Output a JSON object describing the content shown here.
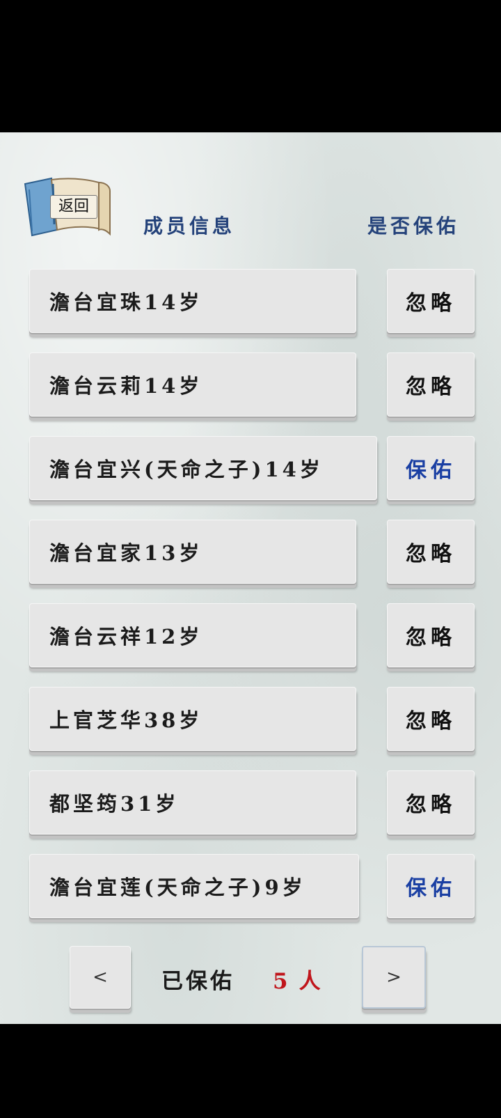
{
  "header": {
    "back_label": "返回",
    "col_member_info": "成员信息",
    "col_protect": "是否保佑"
  },
  "members": [
    {
      "name": "澹台宜珠14岁",
      "action": "忽略"
    },
    {
      "name": "澹台云莉14岁",
      "action": "忽略"
    },
    {
      "name": "澹台宜兴(天命之子)14岁",
      "action": "保佑"
    },
    {
      "name": "澹台宜家13岁",
      "action": "忽略"
    },
    {
      "name": "澹台云祥12岁",
      "action": "忽略"
    },
    {
      "name": "上官芝华38岁",
      "action": "忽略"
    },
    {
      "name": "都坚筠31岁",
      "action": "忽略"
    },
    {
      "name": "澹台宜莲(天命之子)9岁",
      "action": "保佑"
    }
  ],
  "footer": {
    "prev_label": "<",
    "next_label": ">",
    "protected_label": "已保佑",
    "protected_count": "5",
    "protected_unit": "人"
  },
  "colors": {
    "header_text": "#24427a",
    "protect_text": "#1a3fa3",
    "count_text": "#c0161c",
    "background": "#e1e7e5"
  }
}
